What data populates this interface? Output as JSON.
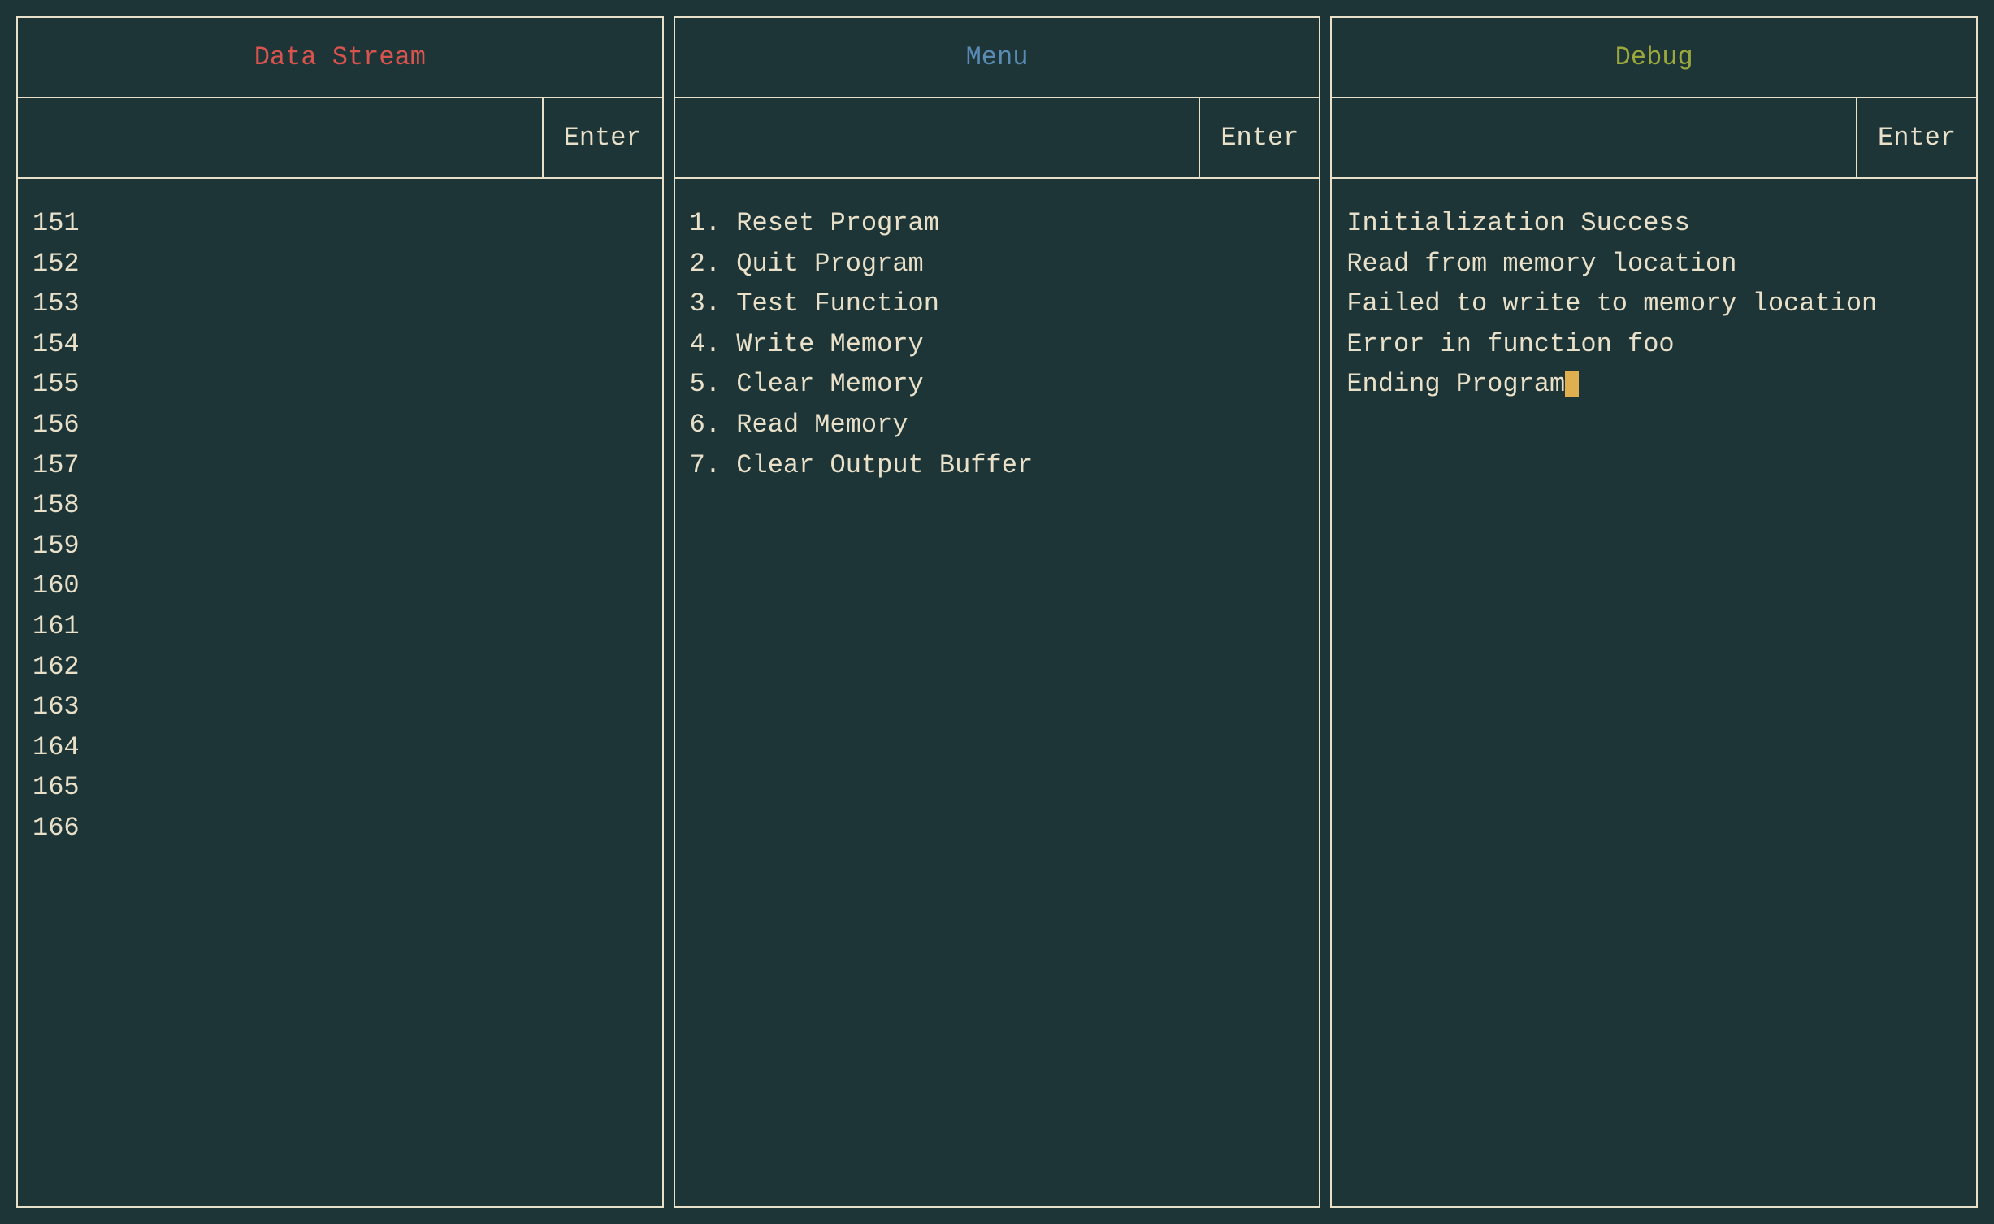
{
  "panels": {
    "data_stream": {
      "title": "Data Stream",
      "enter_label": "Enter",
      "lines": [
        "151",
        "152",
        "153",
        "154",
        "155",
        "156",
        "157",
        "158",
        "159",
        "160",
        "161",
        "162",
        "163",
        "164",
        "165",
        "166"
      ]
    },
    "menu": {
      "title": "Menu",
      "enter_label": "Enter",
      "lines": [
        "1. Reset Program",
        "2. Quit Program",
        "3. Test Function",
        "4. Write Memory",
        "5. Clear Memory",
        "6. Read Memory",
        "7. Clear Output Buffer"
      ]
    },
    "debug": {
      "title": "Debug",
      "enter_label": "Enter",
      "lines": [
        "Initialization Success",
        "Read from memory location",
        "Failed to write to memory location",
        "Error in function foo",
        "Ending Program"
      ]
    }
  },
  "colors": {
    "background": "#1e3538",
    "border": "#e8e0c8",
    "text": "#e8e0c8",
    "red": "#d9534f",
    "blue": "#5a8bb5",
    "green": "#9aa83c",
    "cursor": "#e0b050"
  }
}
